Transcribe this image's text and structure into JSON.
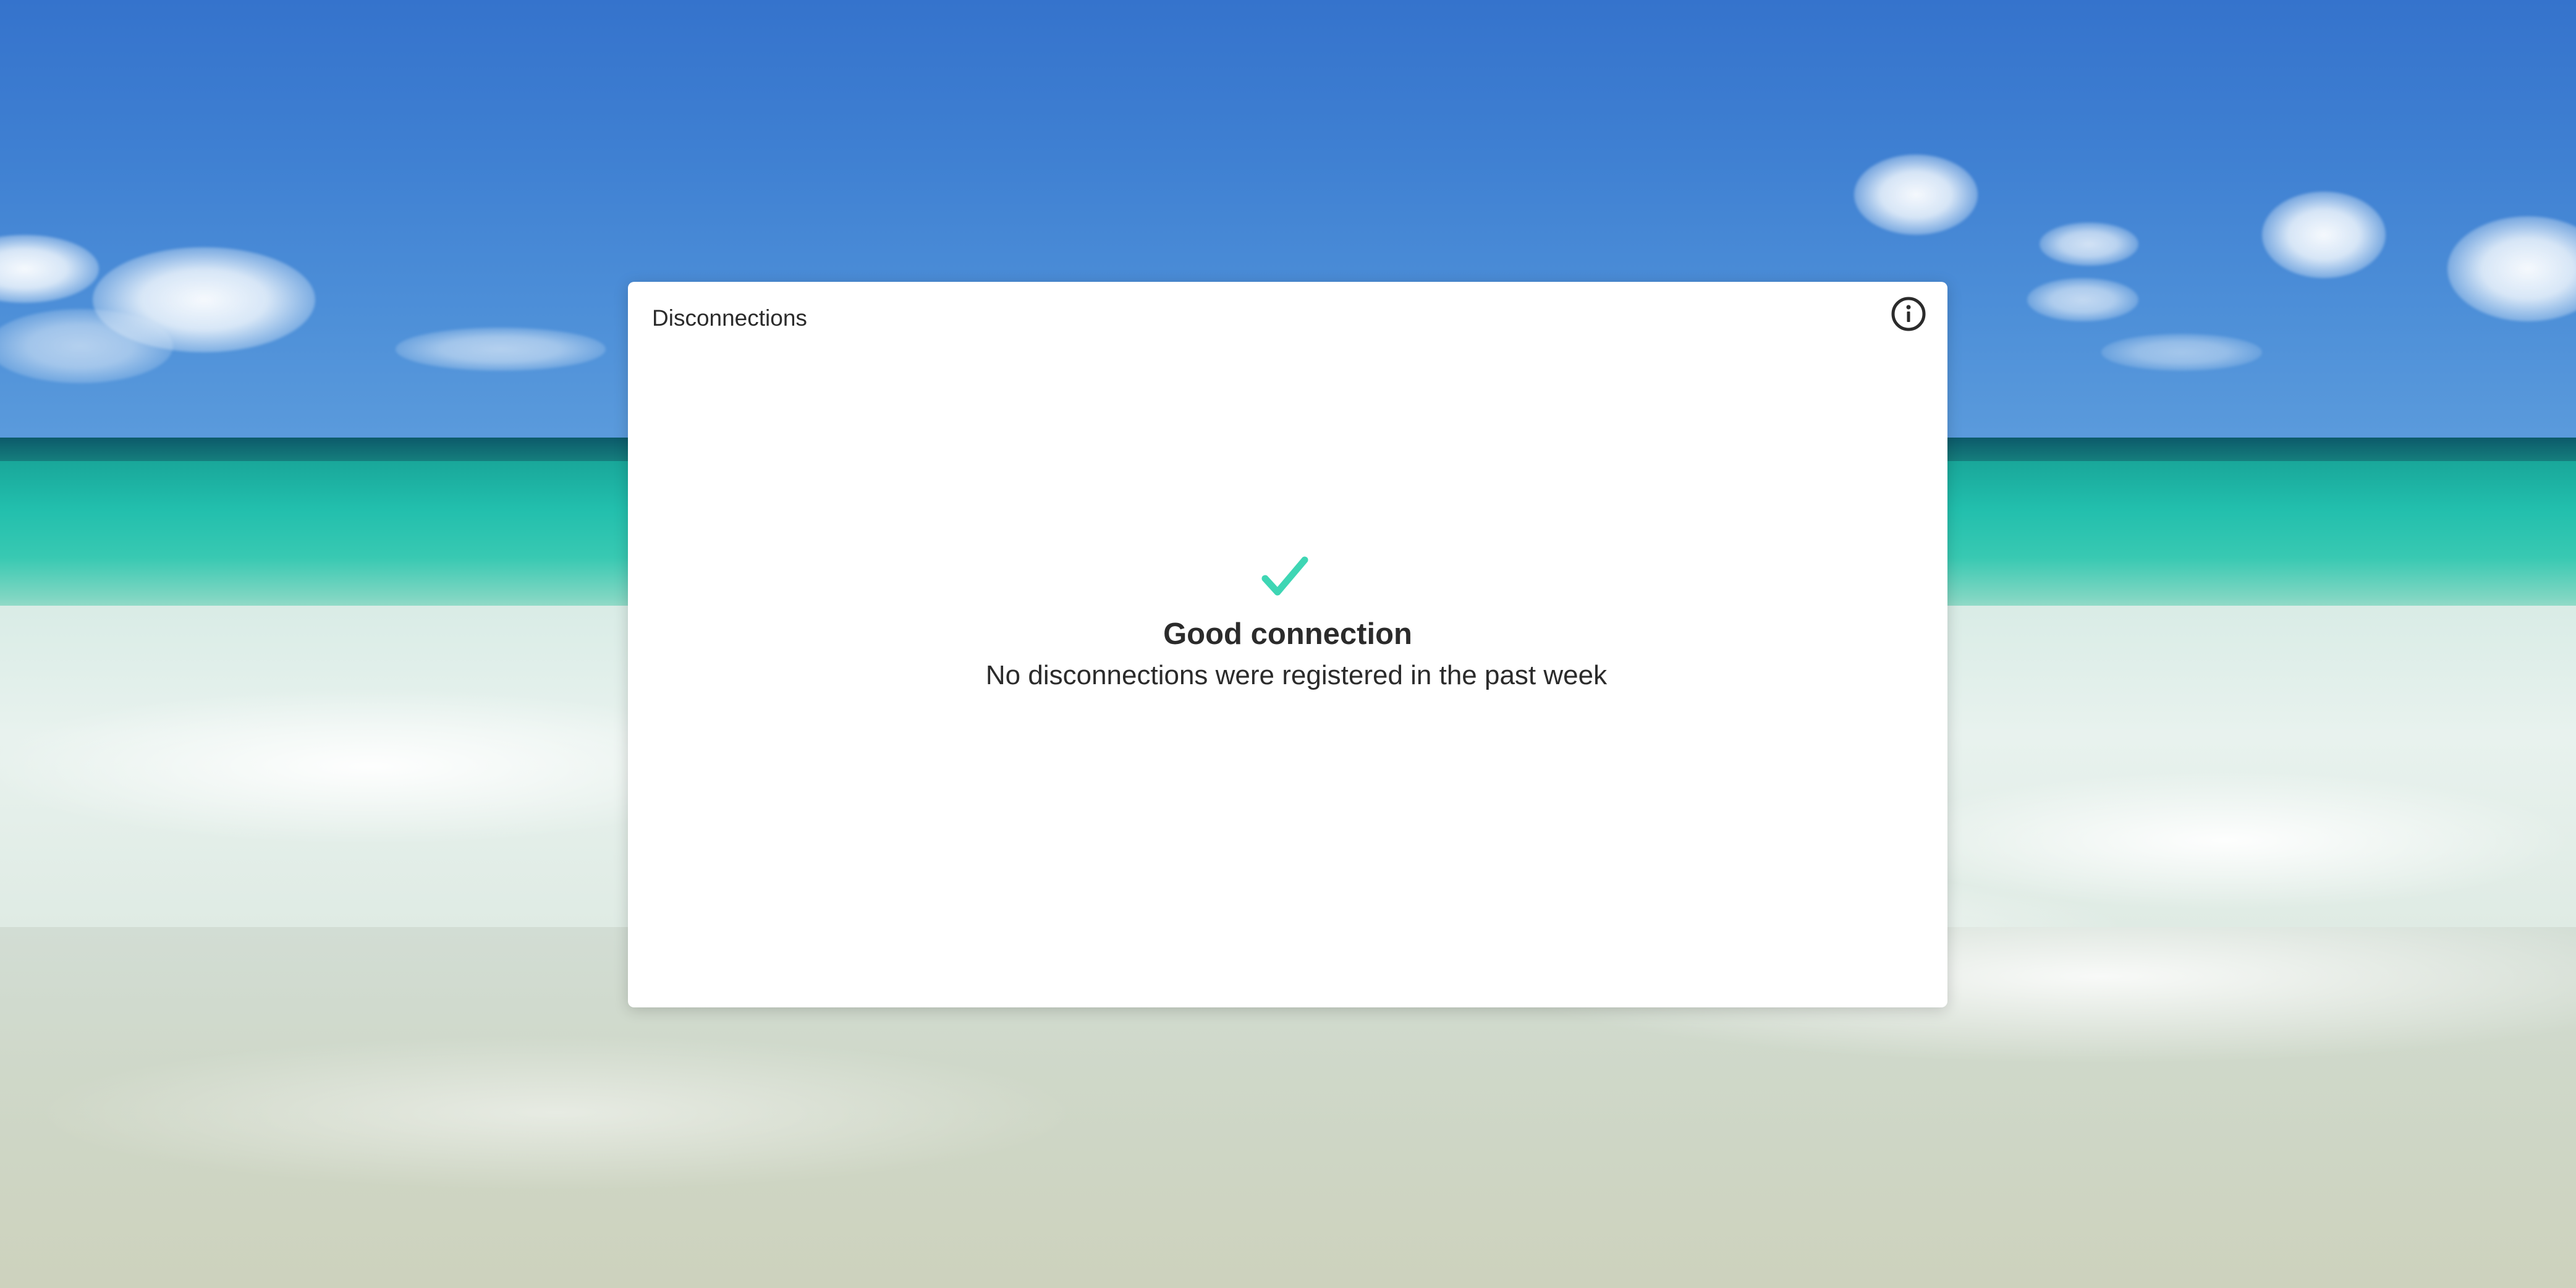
{
  "background": {
    "icon": "beach-photo",
    "sky_color": "#3f80d2",
    "sea_color": "#22bfad"
  },
  "panel": {
    "title": "Disconnections",
    "info_icon": "info-circle-icon",
    "status": {
      "icon": "checkmark-icon",
      "icon_color": "#3ed6b4",
      "title": "Good connection",
      "message": "No disconnections were registered in the past week"
    }
  }
}
